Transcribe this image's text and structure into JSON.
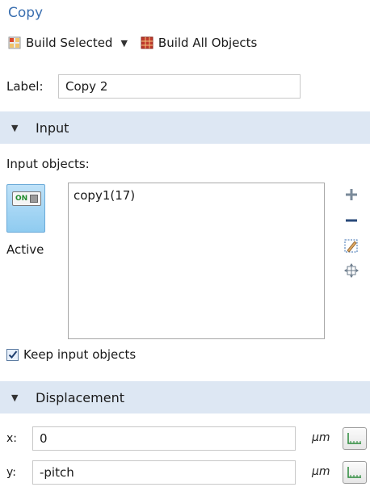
{
  "title": "Copy",
  "toolbar": {
    "build_selected": "Build Selected",
    "build_all": "Build All Objects"
  },
  "label": {
    "caption": "Label:",
    "value": "Copy 2"
  },
  "input_section": {
    "header": "Input",
    "input_objects_label": "Input objects:",
    "active_toggle_text": "ON",
    "active_label": "Active",
    "objects": [
      "copy1(17)"
    ],
    "keep_input_label": "Keep input objects",
    "keep_input_checked": true
  },
  "displacement_section": {
    "header": "Displacement",
    "x": {
      "label": "x:",
      "value": "0",
      "unit": "μm"
    },
    "y": {
      "label": "y:",
      "value": "-pitch",
      "unit": "μm"
    }
  },
  "colors": {
    "title": "#3a6fb0",
    "section_bg": "#dde7f3",
    "active_tile": "#8fcbf0",
    "add_icon": "#7a8a9a",
    "remove_icon": "#2a4a7a"
  },
  "icons": {
    "build_selected": "build-selected-icon",
    "build_all": "build-all-icon",
    "add": "plus-icon",
    "remove": "minus-icon",
    "clear_selection": "clear-selection-icon",
    "zoom_to_selection": "zoom-to-selection-icon",
    "range": "range-icon"
  }
}
